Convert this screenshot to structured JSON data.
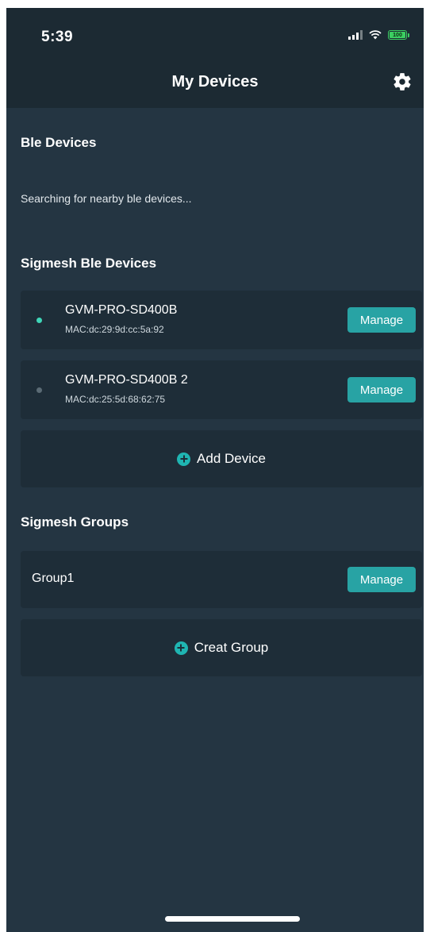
{
  "status": {
    "time": "5:39",
    "battery": "100"
  },
  "nav": {
    "title": "My Devices"
  },
  "ble": {
    "title": "Ble Devices",
    "searching": "Searching for nearby ble devices..."
  },
  "sigmesh_devices": {
    "title": "Sigmesh Ble Devices",
    "items": [
      {
        "name": "GVM-PRO-SD400B",
        "mac": "MAC:dc:29:9d:cc:5a:92",
        "manage": "Manage",
        "online": true
      },
      {
        "name": "GVM-PRO-SD400B 2",
        "mac": "MAC:dc:25:5d:68:62:75",
        "manage": "Manage",
        "online": false
      }
    ],
    "add_label": "Add Device"
  },
  "sigmesh_groups": {
    "title": "Sigmesh Groups",
    "items": [
      {
        "name": "Group1",
        "manage": "Manage"
      }
    ],
    "add_label": "Creat Group"
  },
  "colors": {
    "background": "#243542",
    "card": "#1e2d38",
    "accent": "#28a3a4",
    "online_dot": "#3fd6b8",
    "offline_dot": "#5b6b75"
  }
}
